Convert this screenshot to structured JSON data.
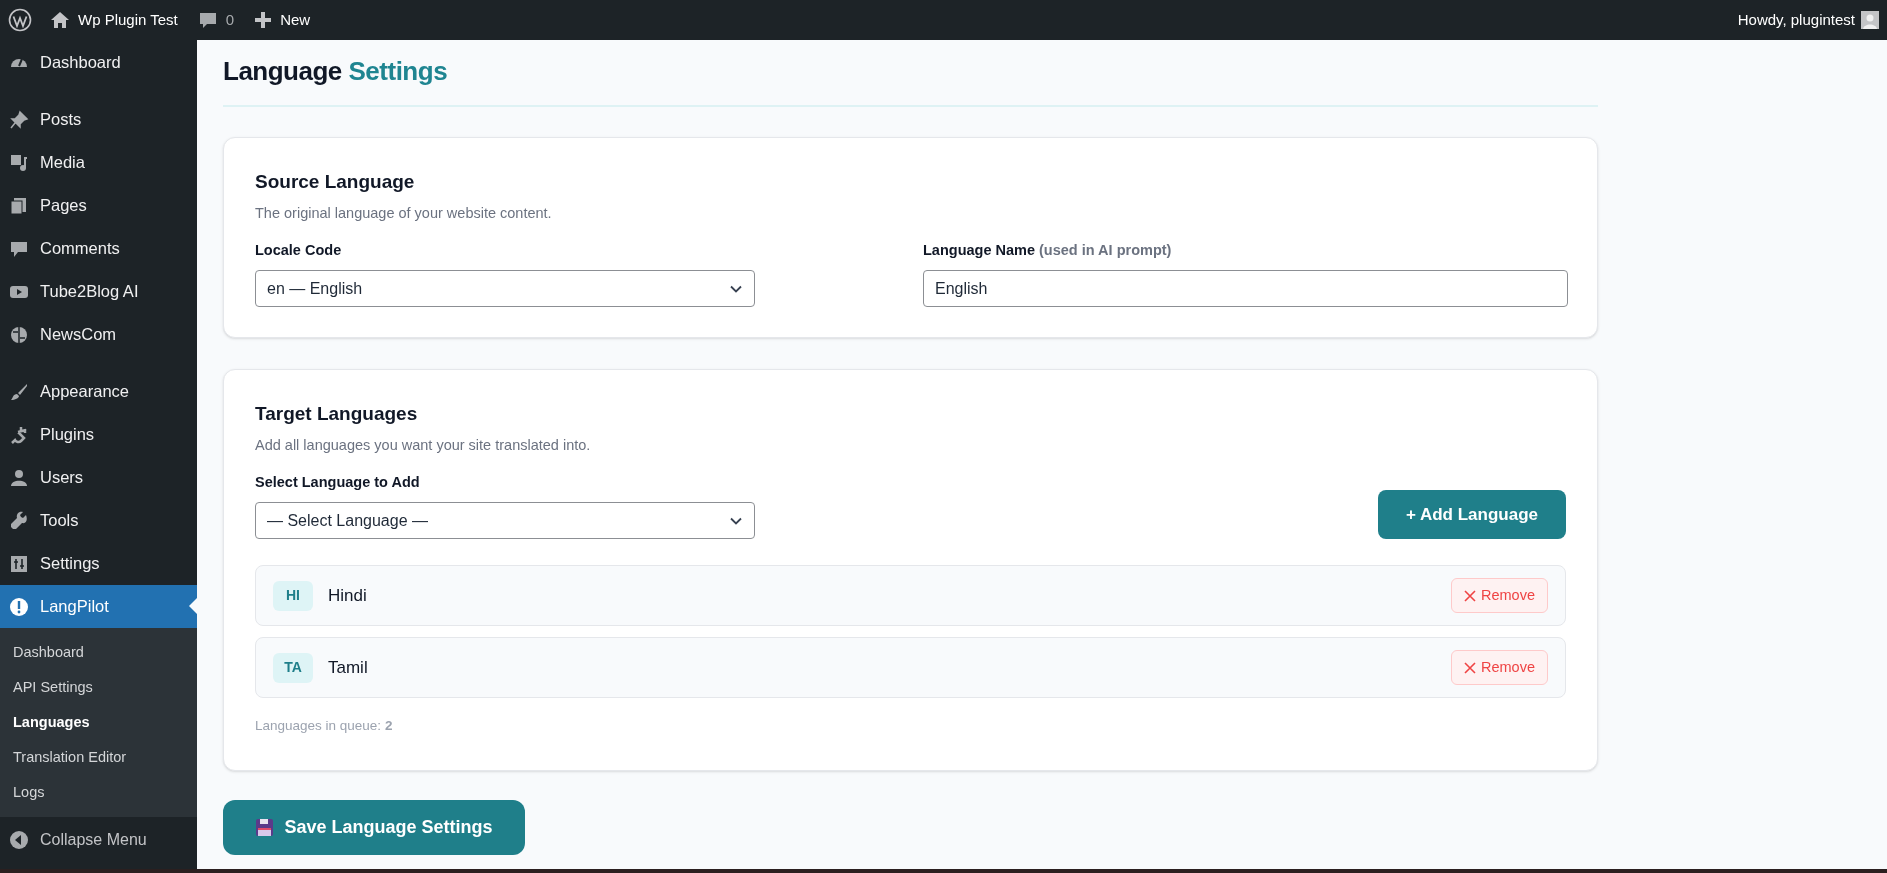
{
  "admin_bar": {
    "site_name": "Wp Plugin Test",
    "comments_count": "0",
    "new_label": "New",
    "greeting": "Howdy, plugintest"
  },
  "sidebar": {
    "groups": [
      [
        {
          "label": "Dashboard",
          "selected": false
        }
      ],
      [
        {
          "label": "Posts",
          "selected": false
        },
        {
          "label": "Media",
          "selected": false
        },
        {
          "label": "Pages",
          "selected": false
        },
        {
          "label": "Comments",
          "selected": false
        },
        {
          "label": "Tube2Blog AI",
          "selected": false
        },
        {
          "label": "NewsCom",
          "selected": false
        }
      ],
      [
        {
          "label": "Appearance",
          "selected": false
        },
        {
          "label": "Plugins",
          "selected": false
        },
        {
          "label": "Users",
          "selected": false
        },
        {
          "label": "Tools",
          "selected": false
        },
        {
          "label": "Settings",
          "selected": false
        },
        {
          "label": "LangPilot",
          "selected": true
        }
      ]
    ],
    "submenu": [
      {
        "label": "Dashboard",
        "selected": false
      },
      {
        "label": "API Settings",
        "selected": false
      },
      {
        "label": "Languages",
        "selected": true
      },
      {
        "label": "Translation Editor",
        "selected": false
      },
      {
        "label": "Logs",
        "selected": false
      }
    ],
    "collapse_label": "Collapse Menu"
  },
  "page": {
    "heading": "Language",
    "heading_accent": "Settings"
  },
  "source_card": {
    "title": "Source Language",
    "description": "The original language of your website content.",
    "locale_label": "Locale Code",
    "locale_value": "en — English",
    "name_label": "Language Name",
    "name_hint": "(used in AI prompt)",
    "name_value": "English"
  },
  "target_card": {
    "title": "Target Languages",
    "description": "Add all languages you want your site translated into.",
    "select_label": "Select Language to Add",
    "select_value": "— Select Language —",
    "add_button": "+ Add Language",
    "languages": [
      {
        "code": "HI",
        "name": "Hindi",
        "remove": "Remove"
      },
      {
        "code": "TA",
        "name": "Tamil",
        "remove": "Remove"
      }
    ],
    "queue_text": "Languages in queue: **2**"
  },
  "save_button": "Save Language Settings"
}
